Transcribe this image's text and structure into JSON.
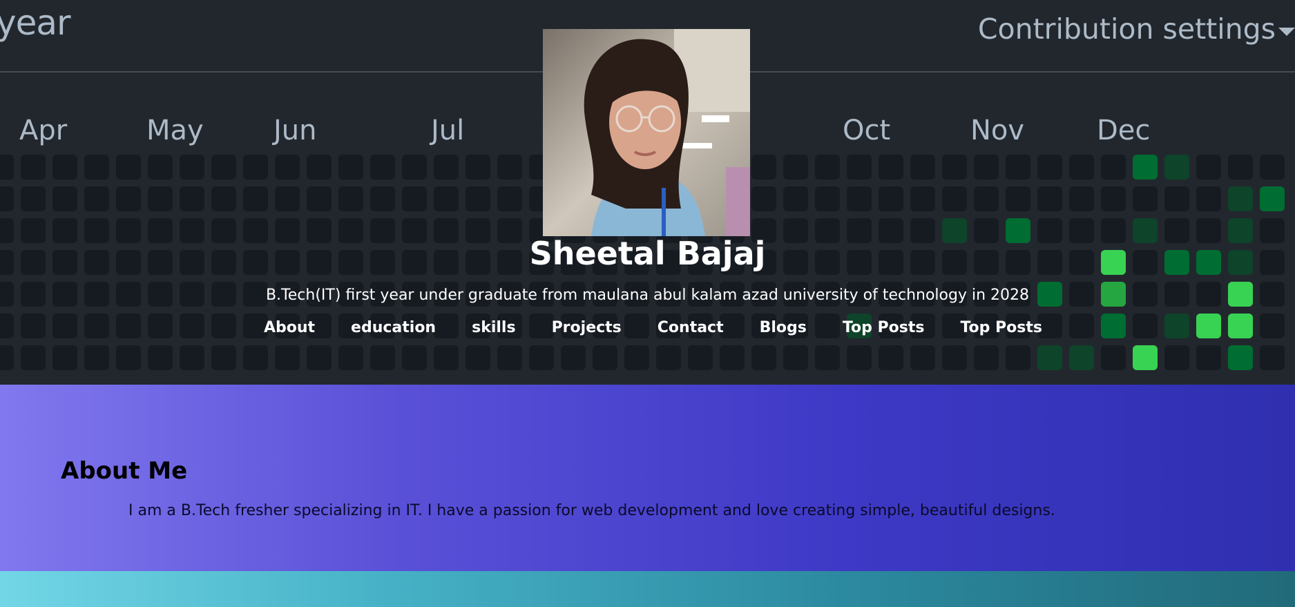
{
  "contribution": {
    "title_fragment": "year",
    "settings_label": "Contribution settings",
    "months": [
      "Apr",
      "May",
      "Jun",
      "Jul",
      "Oct",
      "Nov",
      "Dec"
    ]
  },
  "profile": {
    "name": "Sheetal Bajaj",
    "tagline": "B.Tech(IT) first year under graduate from maulana abul kalam azad university of technology in 2028",
    "nav": [
      "About",
      "education",
      "skills",
      "Projects",
      "Contact",
      "Blogs",
      "Top Posts",
      "Top Posts"
    ]
  },
  "about": {
    "heading": "About Me",
    "text": "I am a B.Tech fresher specializing in IT. I have a passion for web development and love creating simple, beautiful designs."
  },
  "colors": {
    "empty": "#161b22",
    "level1": "#0e4429",
    "level2": "#006d32",
    "level3": "#26a641",
    "level4": "#39d353"
  }
}
